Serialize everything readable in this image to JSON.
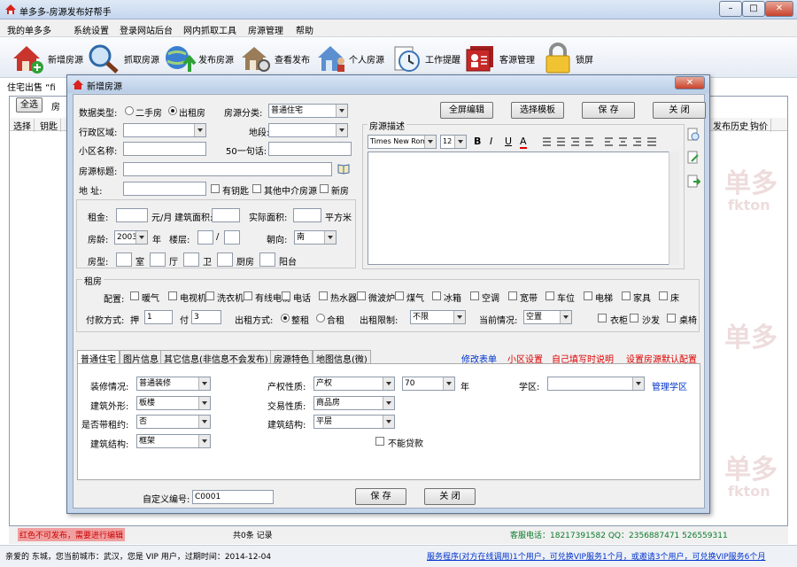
{
  "app": {
    "title": "单多多-房源发布好帮手",
    "window_buttons": [
      "–",
      "□",
      "✕"
    ]
  },
  "menu": [
    "我的单多多",
    "系统设置",
    "登录网站后台",
    "网内抓取工具",
    "房源管理",
    "帮助"
  ],
  "toolbar": [
    {
      "label": "新增房源",
      "icon": "house-plus-icon"
    },
    {
      "label": "抓取房源",
      "icon": "magnifier-icon"
    },
    {
      "label": "发布房源",
      "icon": "globe-upload-icon"
    },
    {
      "label": "查看发布",
      "icon": "house-search-icon"
    },
    {
      "label": "个人房源",
      "icon": "person-house-icon"
    },
    {
      "label": "工作提醒",
      "icon": "clock-notepad-icon"
    },
    {
      "label": "客源管理",
      "icon": "contact-cards-icon"
    },
    {
      "label": "锁屏",
      "icon": "padlock-icon"
    }
  ],
  "main": {
    "tabs_text": "住宅出售  “fi",
    "filter_button": "全选",
    "filter_label": "房",
    "columns_left": [
      "选择",
      "钥匙"
    ],
    "columns_right": [
      "发布历史",
      "钩价"
    ],
    "footer_notice": "红色不可发布，需要进行编辑",
    "footer_count": "共0条 记录",
    "footer_phone": "客服电话：18217391582 QQ：2356887471 526559311"
  },
  "status": {
    "left": "亲爱的 东城，您当前城市：武汉，您是 VIP 用户，过期时间：2014-12-04",
    "right": "服务程序(对方在线调用)1个用户，可兑换VIP服务1个月，或邀请3个用户，可兑换VIP服务6个月"
  },
  "watermark": [
    "单多",
    "fkton"
  ],
  "dialog": {
    "title": "新增房源",
    "close_label": "✕",
    "fields": {
      "data_type_label": "数据类型:",
      "type_options": [
        "二手房",
        "出租房"
      ],
      "type_selected": "出租房",
      "category_label": "房源分类:",
      "category_value": "普通住宅",
      "district_label": "行政区域:",
      "district_value": "",
      "section_label": "地段:",
      "section_value": "",
      "community_label": "小区名称:",
      "community_value": "",
      "one_liner_label": "50一句话:",
      "one_liner_value": "",
      "listing_title_label": "房源标题:",
      "listing_title_value": "",
      "address_label": "地    址:",
      "address_value": "",
      "addr_checks": [
        "有钥匙",
        "其他中介房源",
        "新房"
      ]
    },
    "details": {
      "rent_label": "租金:",
      "rent_unit": "元/月",
      "build_area_label": "建筑面积:",
      "real_area_label": "实际面积:",
      "area_unit": "平方米",
      "age_label": "房龄:",
      "age_value": "2003",
      "age_unit": "年",
      "floor_label": "楼层:",
      "floor_sep": "/",
      "direction_label": "朝向:",
      "direction_value": "南",
      "layout_label": "房型:",
      "room_unit": "室",
      "hall_unit": "厅",
      "bath_unit": "卫",
      "kitchen_unit": "厨房",
      "balcony_unit": "阳台"
    },
    "description": {
      "label": "房源描述",
      "font_name": "Times New Rom",
      "font_size": "12",
      "format_buttons": [
        "B",
        "I",
        "U",
        "A"
      ]
    },
    "top_buttons": [
      "全屏编辑",
      "选择模板",
      "保 存",
      "关 闭"
    ],
    "facilities": {
      "label": "租房",
      "config_label": "配置:",
      "items": [
        "暖气",
        "电视机",
        "洗衣机",
        "有线电视",
        "电话",
        "热水器",
        "微波炉",
        "煤气",
        "冰箱",
        "空调",
        "宽带",
        "车位",
        "电梯",
        "家具",
        "床"
      ],
      "payment_label": "付款方式:",
      "pay_deposit": "押",
      "pay_deposit_value": "1",
      "pay_label": "付",
      "pay_value": "3",
      "rent_mode_label": "出租方式:",
      "rent_modes": [
        "整租",
        "合租"
      ],
      "rent_mode_selected": "整租",
      "limit_label": "出租限制:",
      "limit_value": "不限",
      "current_label": "当前情况:",
      "current_value": "空置",
      "extra_checks": [
        "衣柜",
        "沙发",
        "桌椅"
      ]
    },
    "tabs": [
      "普通住宅",
      "图片信息",
      "其它信息(非信息不会发布)",
      "房源特色",
      "地图信息(微)"
    ],
    "links": [
      {
        "text": "修改表单",
        "style": "blue"
      },
      {
        "text": "小区设置",
        "style": "red"
      },
      {
        "text": "自己填写时说明",
        "style": "red"
      },
      {
        "text": "设置房源默认配置",
        "style": "red"
      }
    ],
    "tab_fields": {
      "decoration_label": "装修情况:",
      "decoration_value": "普通装修",
      "property_label": "产权性质:",
      "property_value": "产权",
      "years_value": "70",
      "years_unit": "年",
      "school_label": "学区:",
      "school_value": "",
      "manage_school": "管理学区",
      "shape_label": "建筑外形:",
      "shape_value": "板楼",
      "trade_label": "交易性质:",
      "trade_value": "商品房",
      "lease_label": "是否带租约:",
      "lease_value": "否",
      "structure_label": "建筑结构:",
      "structure_value": "平层",
      "build_label": "建筑结构:",
      "build_value": "框架",
      "no_loan": "不能贷款"
    },
    "custom_no_label": "自定义编号:",
    "custom_no_value": "C0001",
    "bottom_buttons": [
      "保 存",
      "关 闭"
    ]
  }
}
